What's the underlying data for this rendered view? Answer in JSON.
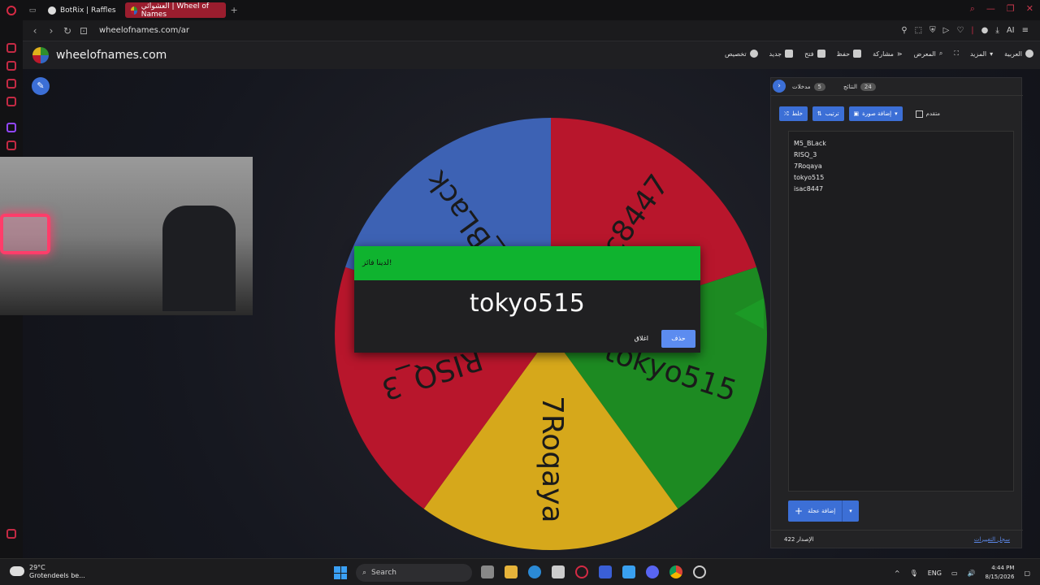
{
  "browser": {
    "tabs": [
      {
        "label": "BotRix | Raffles",
        "active": false
      },
      {
        "label": "العشوائي | Wheel of Names",
        "active": true
      }
    ],
    "new_tab": "+",
    "url": "wheelofnames.com/ar",
    "ai_label": "AI"
  },
  "site": {
    "title": "wheelofnames.com",
    "menu": [
      "العربية",
      "المزيد",
      "",
      "المعرض",
      "مشاركة",
      "حفظ",
      "فتح",
      "جديد",
      "تخصيص"
    ]
  },
  "wheel": {
    "segments": [
      {
        "label": "isac8447",
        "color": "#b8162c"
      },
      {
        "label": "tokyo515",
        "color": "#1d8a22"
      },
      {
        "label": "7Roqaya",
        "color": "#d6a81b"
      },
      {
        "label": "RISQ_3",
        "color": "#b8162c"
      },
      {
        "label": "M5_BLack",
        "color": "#3d62b4"
      }
    ],
    "pointer_color": "#1c9a26"
  },
  "dialog": {
    "header": "لدينا فائز!",
    "winner": "tokyo515",
    "remove_label": "حذف",
    "close_label": "اغلاق",
    "header_color": "#0fb32f"
  },
  "panel": {
    "tabs": [
      {
        "label": "مدخلات",
        "count": "5"
      },
      {
        "label": "النتائج",
        "count": "24"
      }
    ],
    "toolbar": {
      "shuffle": "خلط",
      "sort": "ترتيب",
      "add_image": "إضافة صورة",
      "advanced": "متقدم"
    },
    "entries": [
      "M5_BLack",
      "RISQ_3",
      "7Roqaya",
      "tokyo515",
      "isac8447"
    ],
    "add_image_button": "إضافة عجلة",
    "version": "الإصدار 422",
    "changelog": "سجل التغييرات"
  },
  "taskbar": {
    "weather_temp": "29°C",
    "weather_text": "Grotendeels be...",
    "search": "Search",
    "lang": "ENG",
    "time": "4:44 PM",
    "date": "8/15/2026"
  }
}
